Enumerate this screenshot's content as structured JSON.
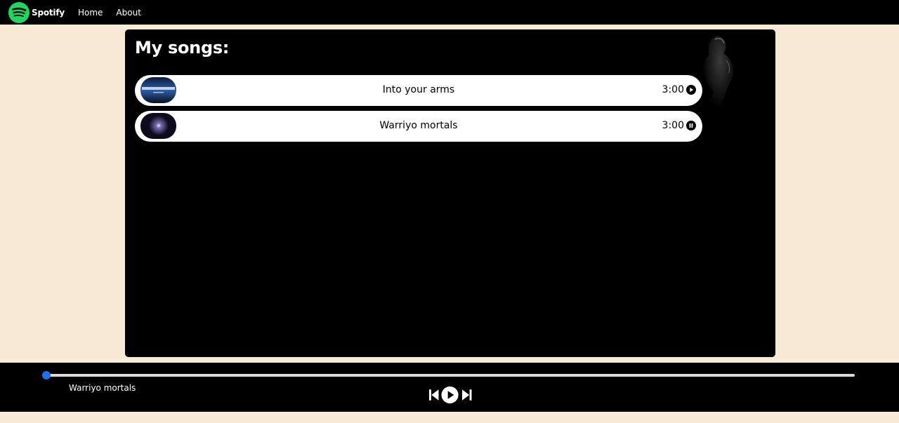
{
  "nav": {
    "brand": "Spotify",
    "links": [
      {
        "label": "Home"
      },
      {
        "label": "About"
      }
    ]
  },
  "main": {
    "heading": "My songs:",
    "songs": [
      {
        "title": "Into your arms",
        "duration": "3:00",
        "state": "play-icon"
      },
      {
        "title": "Warriyo mortals",
        "duration": "3:00",
        "state": "pause-icon"
      }
    ]
  },
  "player": {
    "now_playing": "Warriyo mortals",
    "progress_percent": 0
  },
  "colors": {
    "page_background": "#f9ead8",
    "panel": "#000000",
    "brand_green": "#1ed760",
    "progress_accent": "#1a73e8"
  }
}
